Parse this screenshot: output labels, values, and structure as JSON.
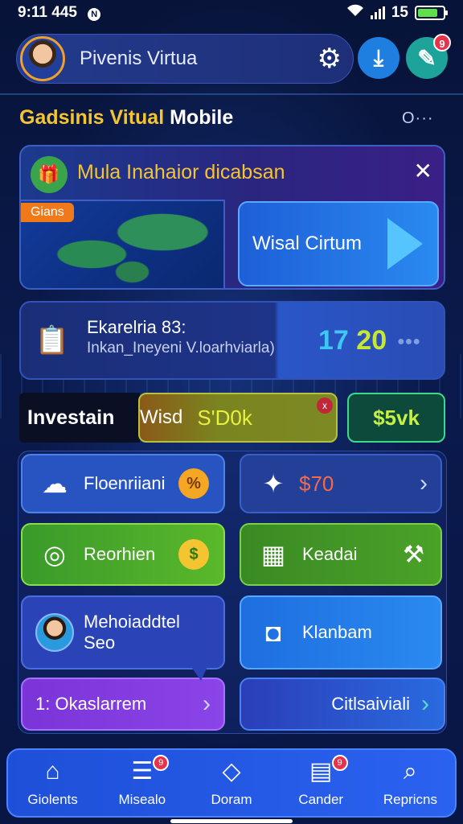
{
  "status": {
    "time": "9:11 445",
    "notif": "N",
    "network": "15",
    "battery_level": 0.8
  },
  "header": {
    "user_name": "Pivenis Virtua",
    "badge": "9"
  },
  "section": {
    "title_yellow": "Gadsinis Vitual",
    "title_white": "Mobile",
    "more": "O···"
  },
  "promo": {
    "title": "Mula Inahaior dicabsan",
    "map_tag": "Gians",
    "video_label": "Wisal Cirtum"
  },
  "stats": {
    "title": "Ekarelria 83:",
    "subtitle": "Inkan_Ineyeni V.loarhviarla)",
    "value_blue": "17",
    "value_green": "20"
  },
  "investment": {
    "label": "Investain",
    "bar_part": "Wisd",
    "bar_amount": "S'D0k",
    "bar_close": "x",
    "pill": "$5vk"
  },
  "tiles": {
    "t1": {
      "label": "Floenriiani",
      "coin": "%"
    },
    "t2": {
      "price": "$70",
      "chevron": "›"
    },
    "t3": {
      "label": "Reorhien",
      "coin": "$"
    },
    "t4": {
      "label": "Keadai"
    },
    "t5": {
      "line1": "Mehoiaddtel",
      "line2": "Seo"
    },
    "t6": {
      "label": "Klanbam"
    },
    "t7": {
      "label": "1: Okaslarrem",
      "chevron": "›"
    },
    "t8": {
      "label": "Citlsaiviali",
      "chevron": "›"
    }
  },
  "nav": [
    {
      "label": "Giolents",
      "icon": "home-icon",
      "badge": ""
    },
    {
      "label": "Misealo",
      "icon": "list-icon",
      "badge": "9"
    },
    {
      "label": "Doram",
      "icon": "document-icon",
      "badge": ""
    },
    {
      "label": "Cander",
      "icon": "calendar-icon",
      "badge": "9"
    },
    {
      "label": "Repricns",
      "icon": "search-icon",
      "badge": ""
    }
  ]
}
